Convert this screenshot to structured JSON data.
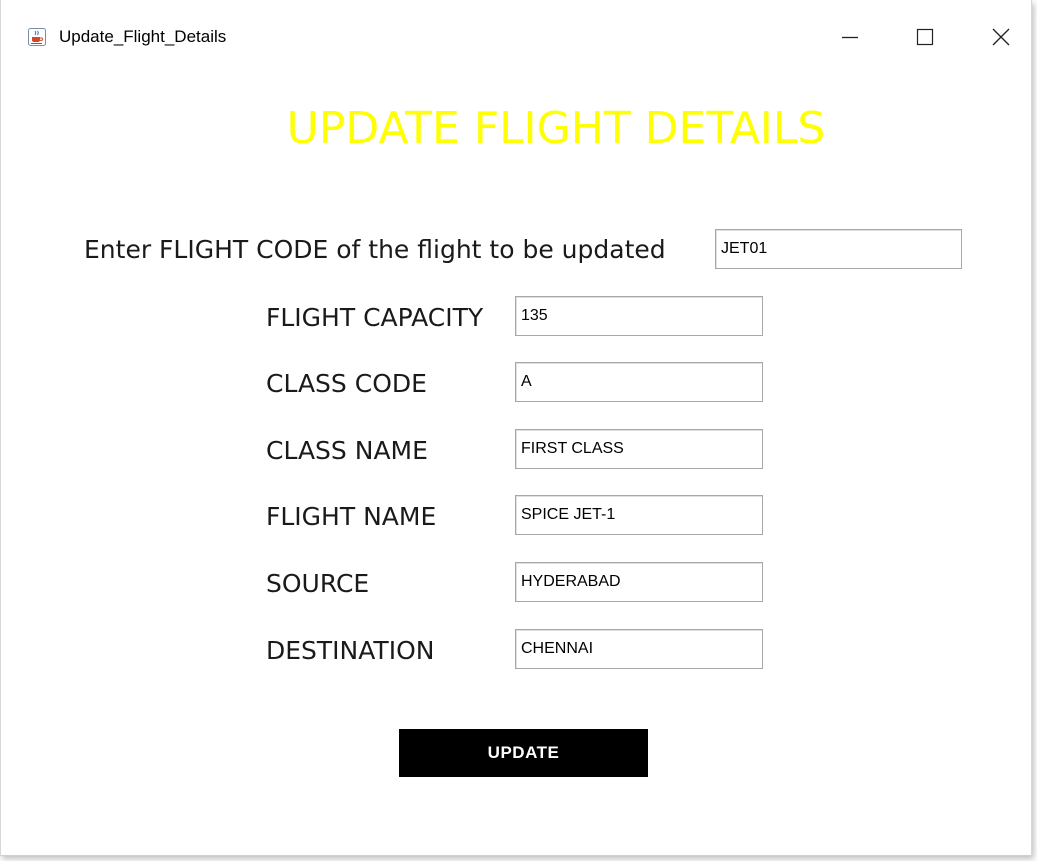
{
  "window": {
    "title": "Update_Flight_Details",
    "icon": "java-cup-icon"
  },
  "heading": "UPDATE FLIGHT DETAILS",
  "heading_color": "#ffff00",
  "flight_code": {
    "label": "Enter FLIGHT CODE of the flight to be updated",
    "value": "JET01"
  },
  "fields": [
    {
      "label": "FLIGHT CAPACITY",
      "value": "135"
    },
    {
      "label": "CLASS CODE",
      "value": "A"
    },
    {
      "label": "CLASS NAME",
      "value": "FIRST CLASS"
    },
    {
      "label": "FLIGHT NAME",
      "value": "SPICE JET-1"
    },
    {
      "label": "SOURCE",
      "value": "HYDERABAD"
    },
    {
      "label": "DESTINATION",
      "value": "CHENNAI"
    }
  ],
  "update_button": {
    "label": "UPDATE",
    "background": "#000000",
    "text_color": "#ffffff"
  }
}
